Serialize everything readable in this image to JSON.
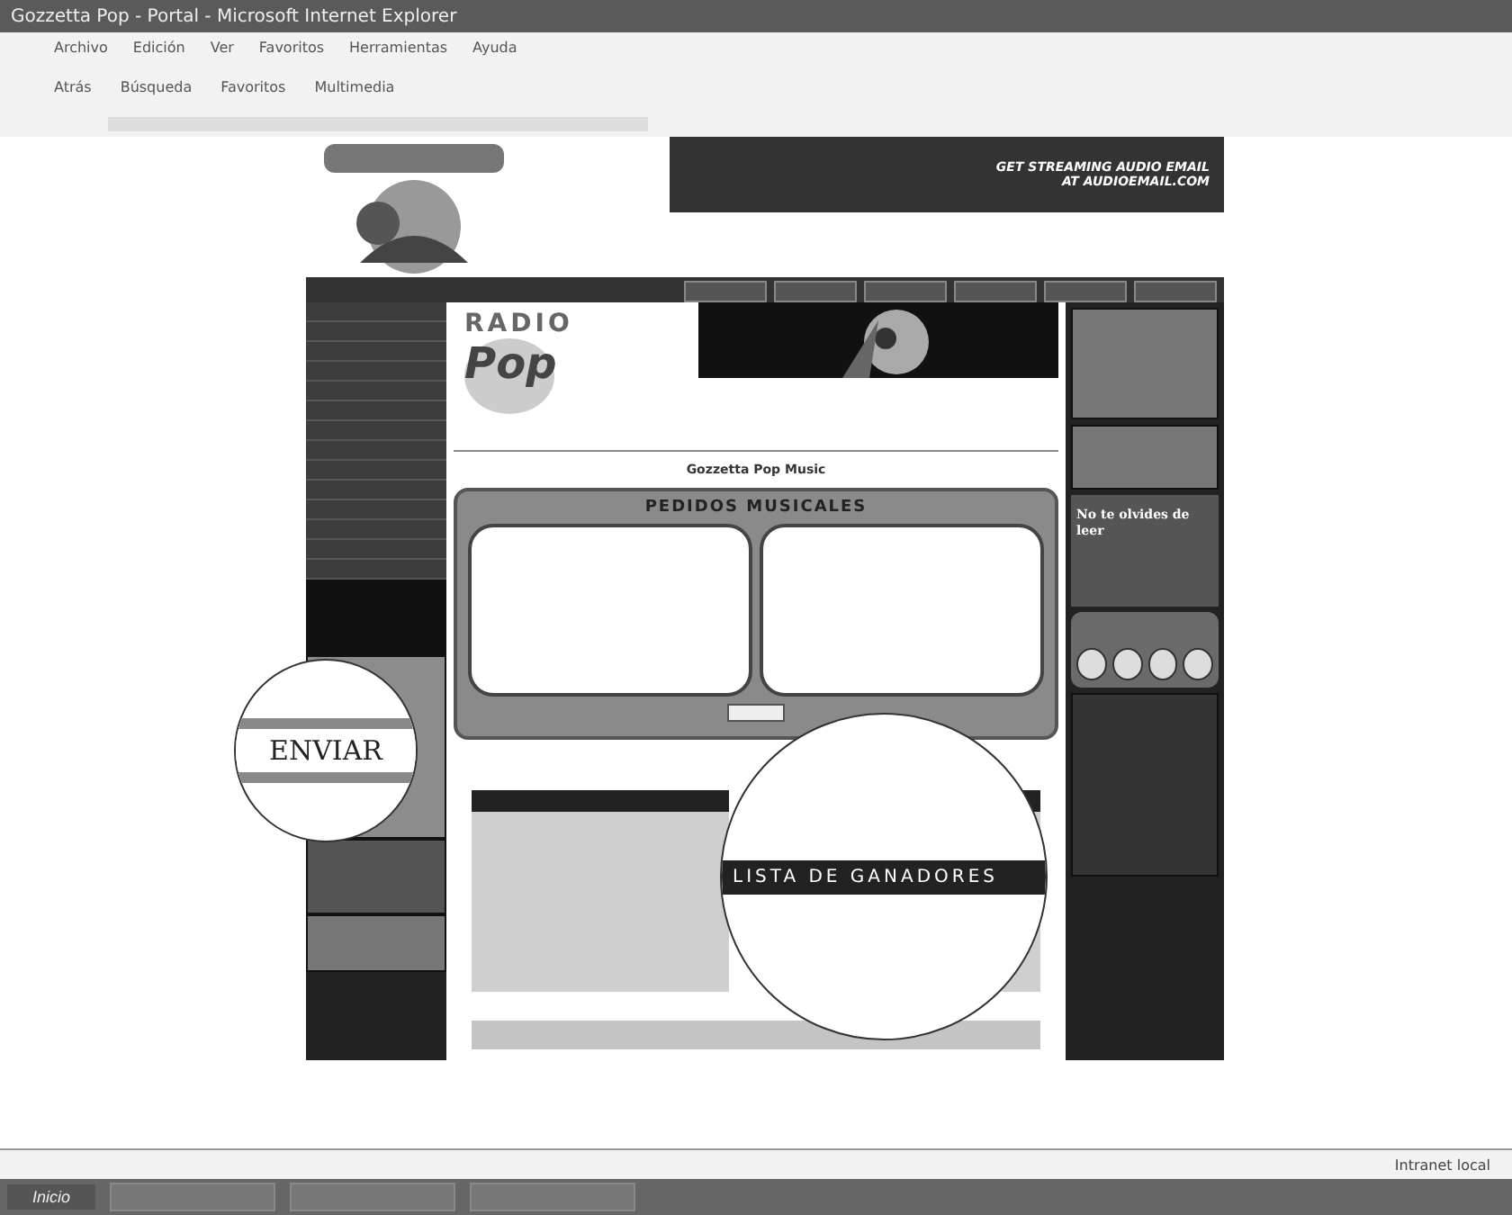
{
  "window": {
    "title": "Gozzetta Pop - Portal - Microsoft Internet Explorer"
  },
  "menu": [
    "Archivo",
    "Edición",
    "Ver",
    "Favoritos",
    "Herramientas",
    "Ayuda"
  ],
  "toolbar": [
    "Atrás",
    "Búsqueda",
    "Favoritos",
    "Multimedia"
  ],
  "banner": {
    "line_1": "GET STREAMING AUDIO EMAIL",
    "line_2": "AT AUDIOEMAIL.COM"
  },
  "radio_logo": {
    "line_1": "RADIO",
    "line_2": "Pop"
  },
  "intro": {
    "brand": "Gozzetta Pop Music"
  },
  "requests": {
    "title": "PEDIDOS MUSICALES"
  },
  "side_promo": "No te olvides de leer",
  "magnifiers": [
    {
      "kind": "button",
      "text": "ENVIAR"
    },
    {
      "kind": "heading",
      "text": "LISTA DE GANADORES"
    }
  ],
  "taskbar": {
    "start": "Inicio"
  },
  "status_bar": {
    "zone": "Intranet local"
  }
}
